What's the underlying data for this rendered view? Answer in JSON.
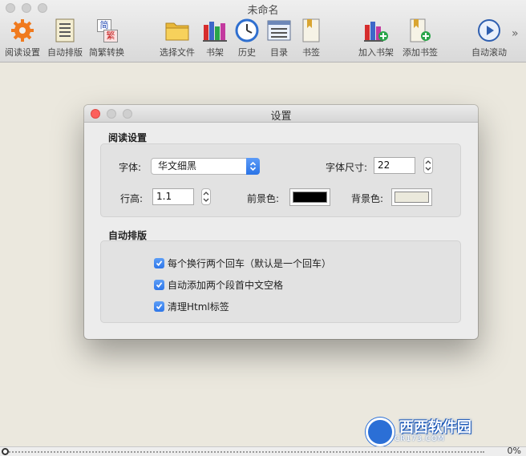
{
  "window": {
    "title": "未命名"
  },
  "toolbar": {
    "items": [
      {
        "label": "阅读设置",
        "icon": "gear-icon"
      },
      {
        "label": "自动排版",
        "icon": "document-lines-icon"
      },
      {
        "label": "简繁转换",
        "icon": "simplified-traditional-icon",
        "glyph_top": "简",
        "glyph_bottom": "繁"
      },
      {
        "label": "选择文件",
        "icon": "folder-icon"
      },
      {
        "label": "书架",
        "icon": "bookshelf-icon"
      },
      {
        "label": "历史",
        "icon": "clock-icon"
      },
      {
        "label": "目录",
        "icon": "list-icon"
      },
      {
        "label": "书签",
        "icon": "bookmark-icon"
      },
      {
        "label": "加入书架",
        "icon": "add-bookshelf-icon"
      },
      {
        "label": "添加书签",
        "icon": "add-bookmark-icon"
      },
      {
        "label": "自动滚动",
        "icon": "play-circle-icon"
      }
    ],
    "overflow": "»"
  },
  "dialog": {
    "title": "设置",
    "reading": {
      "section": "阅读设置",
      "font_label": "字体:",
      "font_value": "华文细黑",
      "font_size_label": "字体尺寸:",
      "font_size_value": "22",
      "line_height_label": "行高:",
      "line_height_value": "1.1",
      "foreground_label": "前景色:",
      "foreground_color": "#000000",
      "background_label": "背景色:",
      "background_color": "#ebe9dc"
    },
    "layout": {
      "section": "自动排版",
      "options": [
        {
          "label": "每个换行两个回车（默认是一个回车）",
          "checked": true
        },
        {
          "label": "自动添加两个段首中文空格",
          "checked": true
        },
        {
          "label": "清理Html标签",
          "checked": true
        }
      ]
    }
  },
  "status": {
    "progress_percent": 0,
    "progress_text": "0%"
  },
  "watermark": {
    "brand": "西西软件园",
    "url": "CR173.COM"
  },
  "colors": {
    "accent": "#2e76e9",
    "page_background": "#ebe8de",
    "close_red": "#fc605c"
  }
}
